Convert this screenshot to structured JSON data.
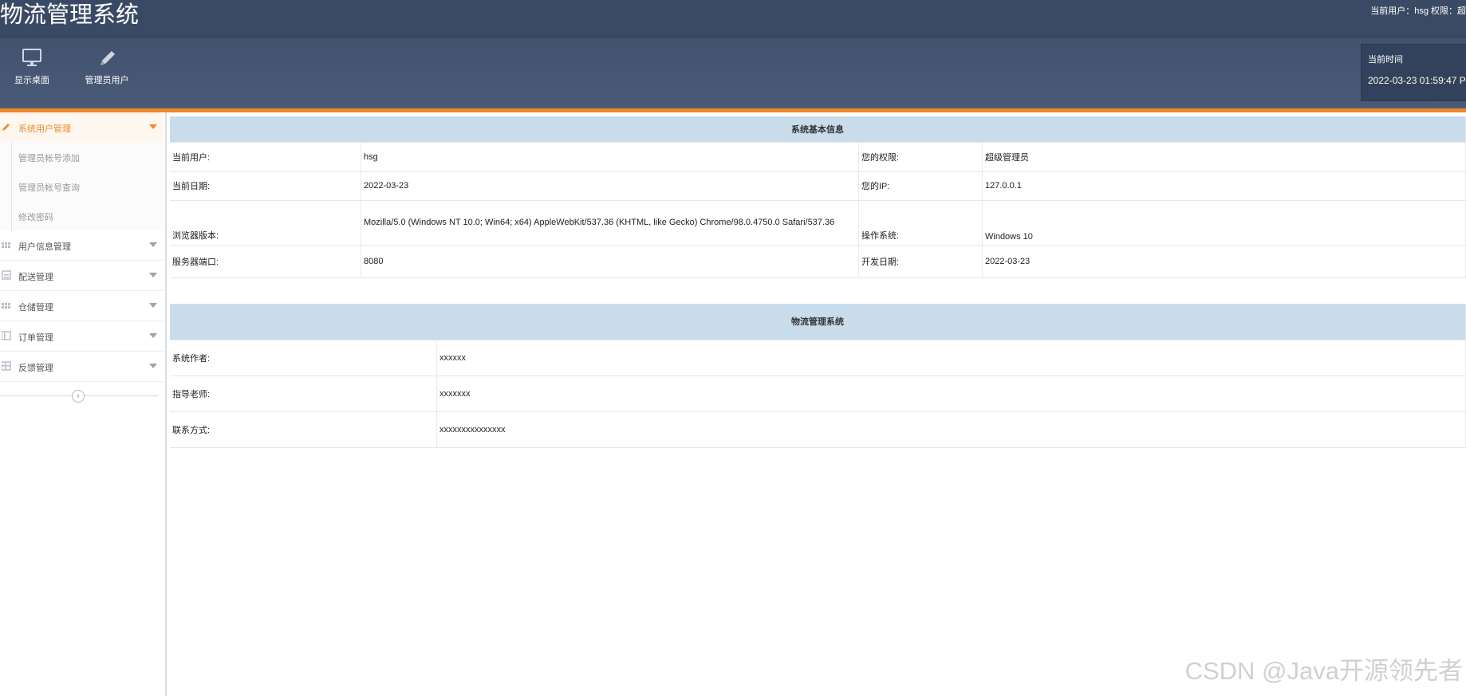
{
  "header": {
    "app_title": "物流管理系统",
    "user_info": "当前用户：hsg  权限：超",
    "toolbar": [
      {
        "label": "显示桌面",
        "icon": "monitor-icon"
      },
      {
        "label": "管理员用户",
        "icon": "pencil-icon"
      }
    ],
    "time_label": "当前时间",
    "time_value": "2022-03-23 01:59:47 P"
  },
  "sidebar": {
    "active_menu": {
      "label": "系统用户管理",
      "icon": "pencil-icon"
    },
    "sub_items": [
      "管理员帐号添加",
      "管理员帐号查询",
      "修改密码"
    ],
    "menus": [
      {
        "label": "用户信息管理",
        "icon": "grid-icon"
      },
      {
        "label": "配送管理",
        "icon": "document-icon"
      },
      {
        "label": "仓储管理",
        "icon": "grid-icon"
      },
      {
        "label": "订单管理",
        "icon": "list-icon"
      },
      {
        "label": "反馈管理",
        "icon": "table-icon"
      }
    ],
    "collapse_icon": "chevron-left-icon"
  },
  "basic_info": {
    "title": "系统基本信息",
    "rows": [
      {
        "label1": "当前用户:",
        "value1": "hsg",
        "label2": "您的权限:",
        "value2": "超级管理员"
      },
      {
        "label1": "当前日期:",
        "value1": "2022-03-23",
        "label2": "您的IP:",
        "value2": "127.0.0.1"
      },
      {
        "label1": "浏览器版本:",
        "value1": "Mozilla/5.0 (Windows NT 10.0; Win64; x64) AppleWebKit/537.36 (KHTML, like Gecko) Chrome/98.0.4750.0 Safari/537.36",
        "label2": "操作系统:",
        "value2": "Windows 10"
      },
      {
        "label1": "服务器端口:",
        "value1": "8080",
        "label2": "开发日期:",
        "value2": "2022-03-23"
      }
    ]
  },
  "system_info": {
    "title": "物流管理系统",
    "rows": [
      {
        "label": "系统作者:",
        "value": "xxxxxx"
      },
      {
        "label": "指导老师:",
        "value": "xxxxxxx"
      },
      {
        "label": "联系方式:",
        "value": "xxxxxxxxxxxxxxx"
      }
    ]
  },
  "watermark": "CSDN @Java开源领先者"
}
